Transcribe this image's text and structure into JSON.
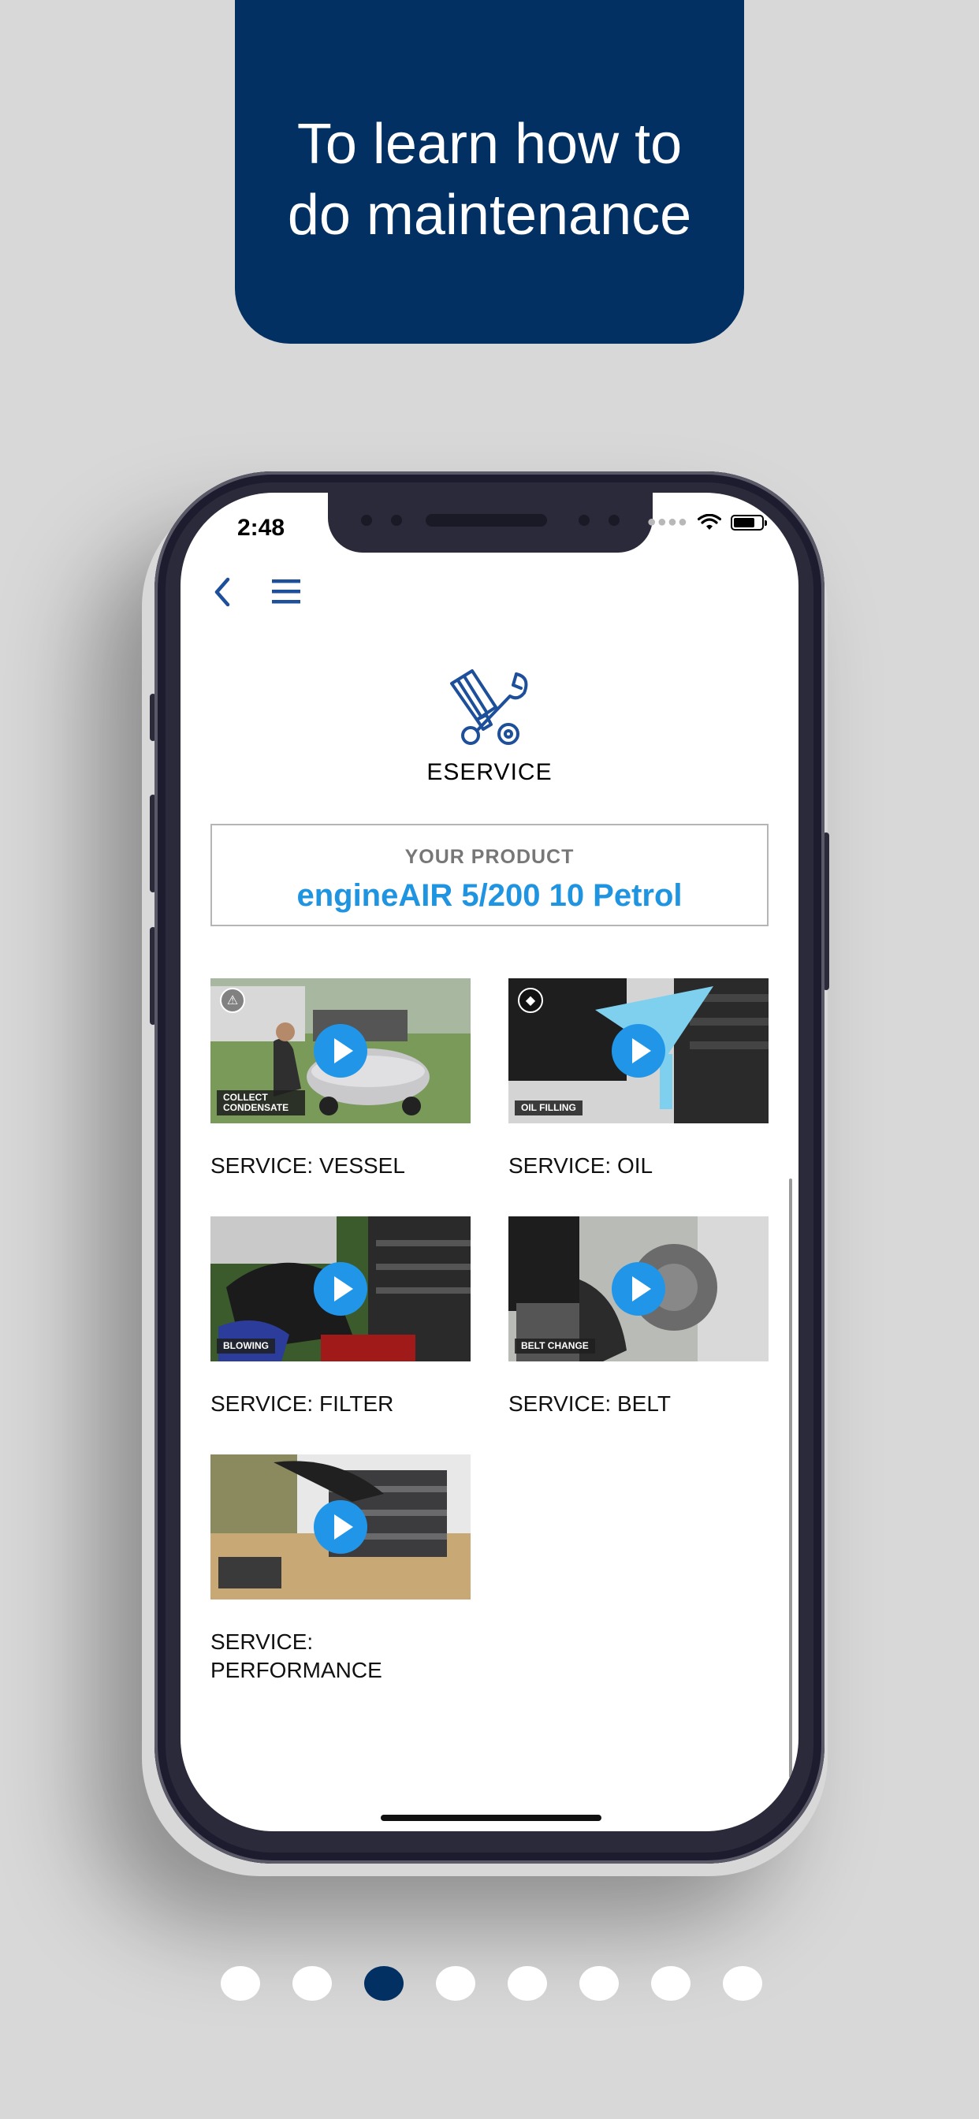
{
  "banner": {
    "line1": "To learn how to",
    "line2": "do maintenance"
  },
  "status": {
    "time": "2:48"
  },
  "nav": {
    "back_icon": "chevron-left-icon",
    "menu_icon": "hamburger-menu-icon"
  },
  "service": {
    "icon": "wrench-and-brush-icon",
    "title": "ESERVICE"
  },
  "product": {
    "label": "YOUR PRODUCT",
    "name": "engineAIR 5/200 10 Petrol"
  },
  "videos": [
    {
      "label": "SERVICE: VESSEL",
      "tag": "COLLECT CONDENSATE",
      "badge": "⚠"
    },
    {
      "label": "SERVICE: OIL",
      "tag": "OIL FILLING",
      "badge": "◆"
    },
    {
      "label": "SERVICE: FILTER",
      "tag": "BLOWING",
      "badge": ""
    },
    {
      "label": "SERVICE: BELT",
      "tag": "BELT CHANGE",
      "badge": ""
    },
    {
      "label": "SERVICE: PERFORMANCE",
      "tag": "",
      "badge": ""
    }
  ],
  "pager": {
    "count": 8,
    "active_index": 2
  },
  "colors": {
    "brand_navy": "#033063",
    "accent_blue": "#1f94e0",
    "play_blue": "#2196e8",
    "background": "#d8d8d8"
  }
}
